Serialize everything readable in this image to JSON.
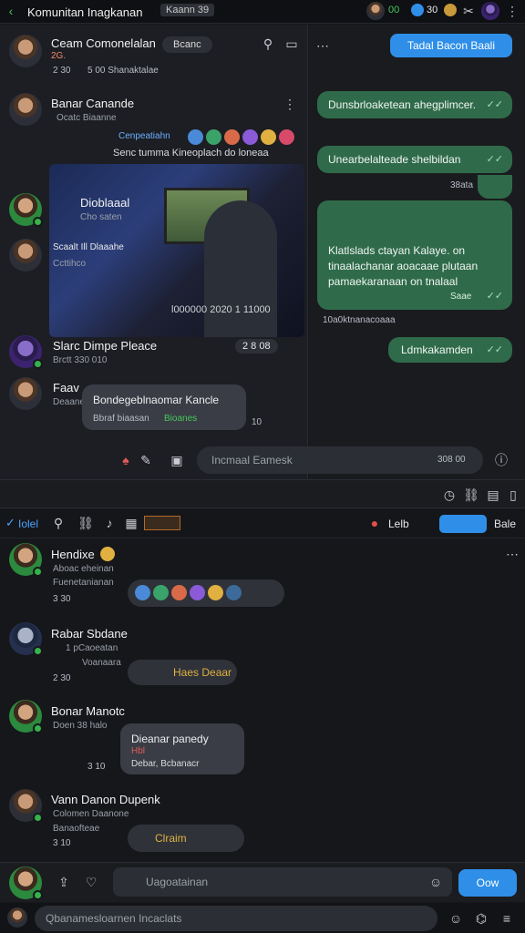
{
  "top_bar": {
    "title": "Komunitan Inagkanan",
    "tag": "Kaann 39",
    "stat1": "00",
    "stat2": "30"
  },
  "left_panel": {
    "header": {
      "name": "Ceam Comonelalan",
      "badge": "Bcanc",
      "sub1": "2G.",
      "meta_time": "2 30",
      "meta_text": "5 00 Shanaktalae"
    },
    "chat1": {
      "name": "Banar Canande",
      "sub": "Ocatc Biaanne",
      "reaction_label": "Cenpeatiahn",
      "snippet": "Senc tumma Kineoplach do loneaa",
      "snippet_meta": "38ha"
    },
    "item2": {
      "name": "Dioblaaal",
      "sub": "Cho saten"
    },
    "item3": {
      "name": "Scaalt Ill Dlaaahe",
      "sub": "Ccttihco"
    },
    "video_caption": "l000000 2020 1 11000",
    "item4": {
      "name": "Slarc Dimpe Pleace",
      "sub": "Brctt 330 010",
      "count": "2 8 08"
    },
    "item5": {
      "name": "Faav",
      "sub": "Deaaner"
    },
    "bubble_left": {
      "title": "Bondegeblnaomar Kancle",
      "meta": "Bbraf biaasan",
      "meta_green": "Bioanes",
      "time": "10"
    }
  },
  "right_panel": {
    "button": "Tadal Bacon Baali",
    "messages": [
      {
        "text": "Dunsbrloaketean ahegplimcer.",
        "time": ""
      },
      {
        "text": "Unearbelalteade shelbildan",
        "time": ""
      },
      {
        "text": "Klatlslads ctayan Kalaye. on",
        "line2": "tinaalachanar aoacaae plutaan",
        "line3": "pamaekaranaan on tnalaal",
        "time": "Saae",
        "highlight": "Kalaye."
      },
      {
        "text": "Ldmkakamden",
        "time": ""
      }
    ],
    "stamp": "38ata",
    "date_line": "10a0ktnanacoaaa"
  },
  "left_input": {
    "placeholder": "Incmaal Eamesk",
    "count": "308 00"
  },
  "divider_bar": {
    "icons_text": "Bale",
    "tab1": "Iolel",
    "tab2": "Lelb"
  },
  "feed": [
    {
      "name": "Hendixe",
      "sub": "Aboac eheinan",
      "sub2": "Fuenetanianan",
      "time": "3 30"
    },
    {
      "name": "Rabar Sbdane",
      "sub": "1 pCaoeatan",
      "sub2": "Voanaara",
      "time": "2 30",
      "tag": "Haes Deaar"
    },
    {
      "name": "Bonar Manotc",
      "sub": "Doen 38 halo",
      "time": "3 10",
      "bubble1": "Dieanar panedy",
      "bubble2": "Hbl",
      "bubble3": "Debar, Bcbanacr"
    },
    {
      "name": "Vann Danon Dupenk",
      "sub": "Colomen Daanone",
      "sub2": "Banaofteae",
      "time": "3 10",
      "tag": "Clraim"
    }
  ],
  "composer": {
    "placeholder": "Uagoatainan",
    "button": "Oow"
  },
  "bottom_input": {
    "placeholder": "Qbanamesloarnen Incaclats"
  },
  "colors": {
    "accent": "#2f8fe8",
    "bubble_green": "#2f6b4a",
    "status": "#35b34a"
  }
}
